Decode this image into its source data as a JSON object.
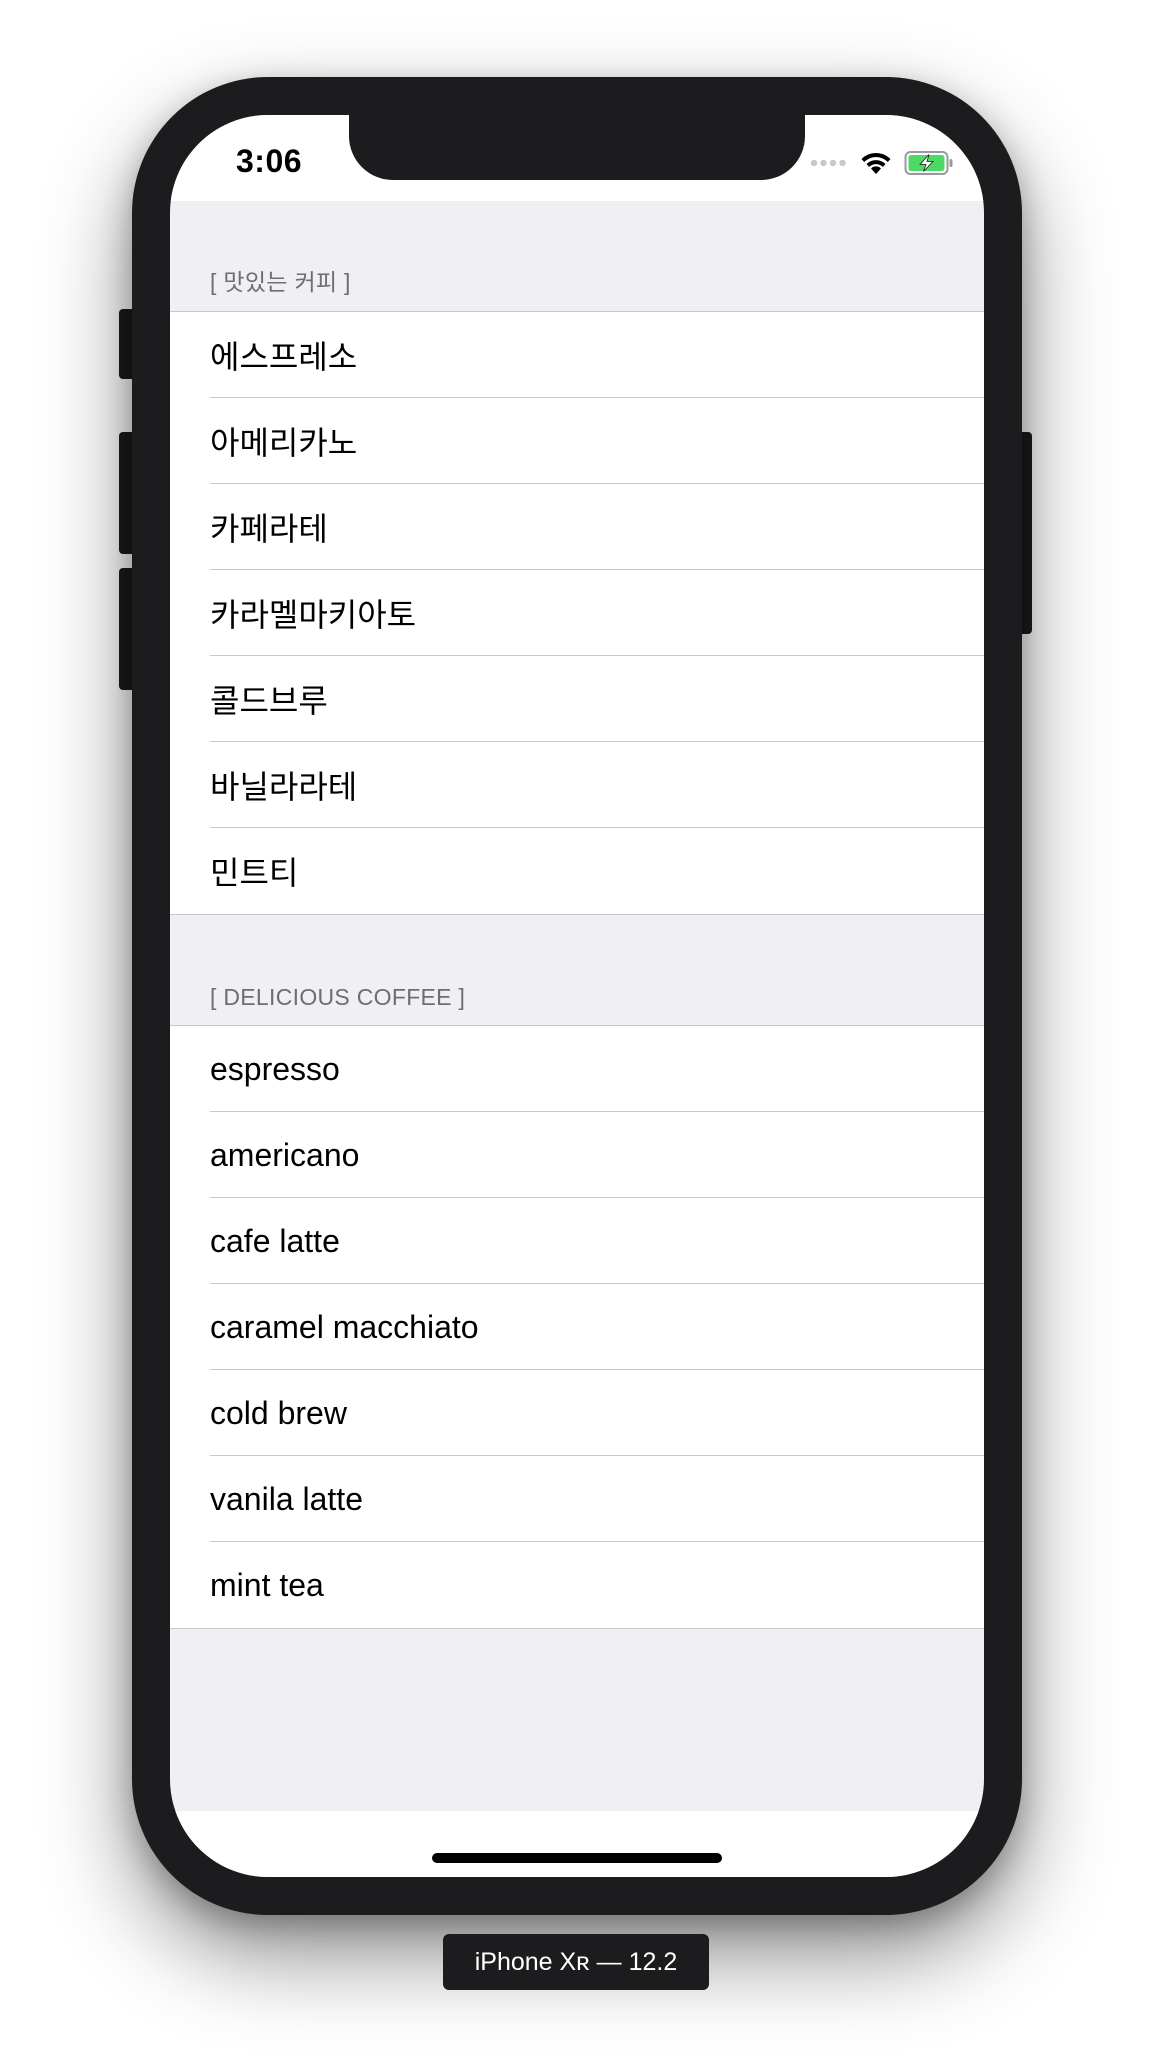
{
  "status_bar": {
    "time": "3:06"
  },
  "table": {
    "sections": [
      {
        "header": "[ 맛있는 커피 ]",
        "items": [
          "에스프레소",
          "아메리카노",
          "카페라테",
          "카라멜마키아토",
          "콜드브루",
          "바닐라라테",
          "민트티"
        ]
      },
      {
        "header": "[ DELICIOUS COFFEE ]",
        "items": [
          "espresso",
          "americano",
          "cafe latte",
          "caramel macchiato",
          "cold brew",
          "vanila latte",
          "mint tea"
        ]
      }
    ]
  },
  "simulator_label": "iPhone Xʀ — 12.2",
  "icons": [
    "signal-icon",
    "wifi-icon",
    "battery-charging-icon"
  ],
  "colors": {
    "grouped_background": "#efeff4",
    "header_text": "#6d6d72",
    "separator": "#c8c7cc",
    "battery_fill": "#4cd964"
  }
}
